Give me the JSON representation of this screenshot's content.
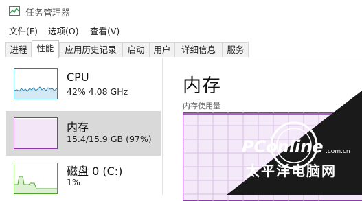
{
  "window": {
    "title": "任务管理器"
  },
  "menu": [
    "文件(F)",
    "选项(O)",
    "查看(V)"
  ],
  "tabs": [
    "进程",
    "性能",
    "应用历史记录",
    "启动",
    "用户",
    "详细信息",
    "服务"
  ],
  "active_tab": "性能",
  "resources": [
    {
      "name": "CPU",
      "detail": "42%  4.08 GHz",
      "color": "#1d84b8",
      "selected": false
    },
    {
      "name": "内存",
      "detail": "15.4/15.9 GB (97%)",
      "color": "#8b38a8",
      "selected": true
    },
    {
      "name": "磁盘 0 (C:)",
      "detail": "1%",
      "color": "#4ea72c",
      "selected": false
    }
  ],
  "detail_panel": {
    "title": "内存",
    "graph_label": "内存使用量",
    "graph_color": "#8b38a8",
    "memory_usage_percent": 97
  },
  "watermark": {
    "brand": "PConline",
    "suffix": ".com.cn",
    "cn_name": "太平洋电脑网"
  }
}
